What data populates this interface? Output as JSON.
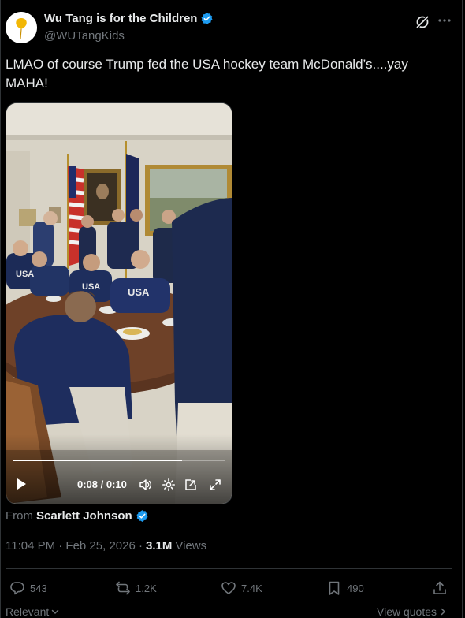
{
  "author": {
    "display_name": "Wu Tang is for the Children",
    "handle": "@WUTangKids"
  },
  "tweet": {
    "text": "LMAO of course Trump fed the USA hockey team McDonald’s....yay MAHA!"
  },
  "video": {
    "time": "0:08 / 0:10",
    "progress": 0.8
  },
  "source": {
    "from_label": "From",
    "from_name": "Scarlett Johnson"
  },
  "meta": {
    "timestamp": "11:04 PM · Feb 25, 2026 ·",
    "views_count": "3.1M",
    "views_label": "Views"
  },
  "actions": {
    "replies": "543",
    "reposts": "1.2K",
    "likes": "7.4K",
    "bookmarks": "490"
  },
  "footer": {
    "relevant": "Relevant",
    "view_quotes": "View quotes"
  },
  "colors": {
    "background": "#000000",
    "primary_text": "#e7e9ea",
    "secondary_text": "#71767b",
    "verified_blue": "#1d9bf0",
    "divider": "#2f3336"
  }
}
